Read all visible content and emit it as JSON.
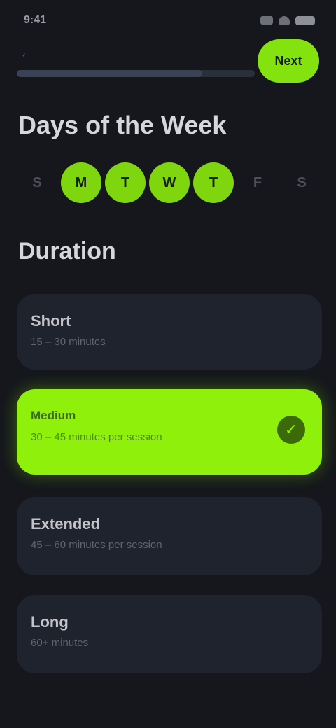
{
  "status_bar": {
    "time": "9:41",
    "icons": [
      "signal-icon",
      "wifi-icon",
      "battery-icon"
    ]
  },
  "header": {
    "back_label": "‹",
    "next_label": "Next",
    "progress": 0.78
  },
  "days": {
    "title": "Days of the Week",
    "items": [
      {
        "label": "S",
        "selected": false
      },
      {
        "label": "M",
        "selected": true
      },
      {
        "label": "T",
        "selected": true
      },
      {
        "label": "W",
        "selected": true
      },
      {
        "label": "T",
        "selected": true
      },
      {
        "label": "F",
        "selected": false
      },
      {
        "label": "S",
        "selected": false
      }
    ]
  },
  "duration": {
    "title": "Duration",
    "options": [
      {
        "title": "Short",
        "subtitle": "15 – 30 minutes",
        "selected": false
      },
      {
        "title": "Medium",
        "subtitle": "30 – 45 minutes per session",
        "selected": true
      },
      {
        "title": "Extended",
        "subtitle": "45 – 60 minutes per session",
        "selected": false
      },
      {
        "title": "Long",
        "subtitle": "60+ minutes",
        "selected": false
      }
    ]
  },
  "colors": {
    "accent": "#8ef00b",
    "background": "#15171c",
    "card": "#1f232d"
  }
}
